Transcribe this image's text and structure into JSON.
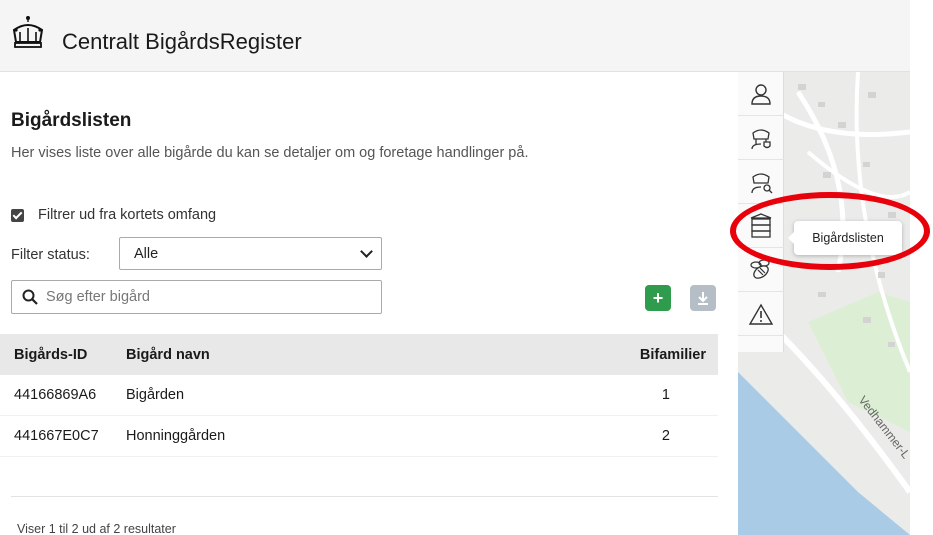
{
  "header": {
    "title": "Centralt BigårdsRegister",
    "logo_icon": "crown-icon"
  },
  "page": {
    "title": "Bigårdslisten",
    "description": "Her vises liste over alle bigårde du kan se detaljer om og foretage handlinger på."
  },
  "filters": {
    "extent_label": "Filtrer ud fra kortets omfang",
    "extent_checked": true,
    "status_label": "Filter status:",
    "status_value": "Alle"
  },
  "search": {
    "placeholder": "Søg efter bigård",
    "icon": "search-icon"
  },
  "actions": {
    "add_label": "+",
    "download_icon": "download-icon"
  },
  "table": {
    "columns": [
      "Bigårds-ID",
      "Bigård navn",
      "Bifamilier"
    ],
    "rows": [
      [
        "44166869A6",
        "Bigården",
        "1"
      ],
      [
        "441667E0C7",
        "Honninggården",
        "2"
      ]
    ]
  },
  "pagination": {
    "text": "Viser 1 til 2 ud af 2 resultater"
  },
  "map": {
    "road_label": "Vedhammer-L",
    "tools": [
      "user-icon",
      "beekeeper-shield-icon",
      "beekeeper-search-icon",
      "beehive-icon",
      "bee-icon",
      "warning-icon"
    ],
    "tooltip": "Bigårdslisten"
  },
  "colors": {
    "add_button": "#2e9b4d",
    "download_button": "#b5bec6",
    "highlight": "#e8000b"
  }
}
